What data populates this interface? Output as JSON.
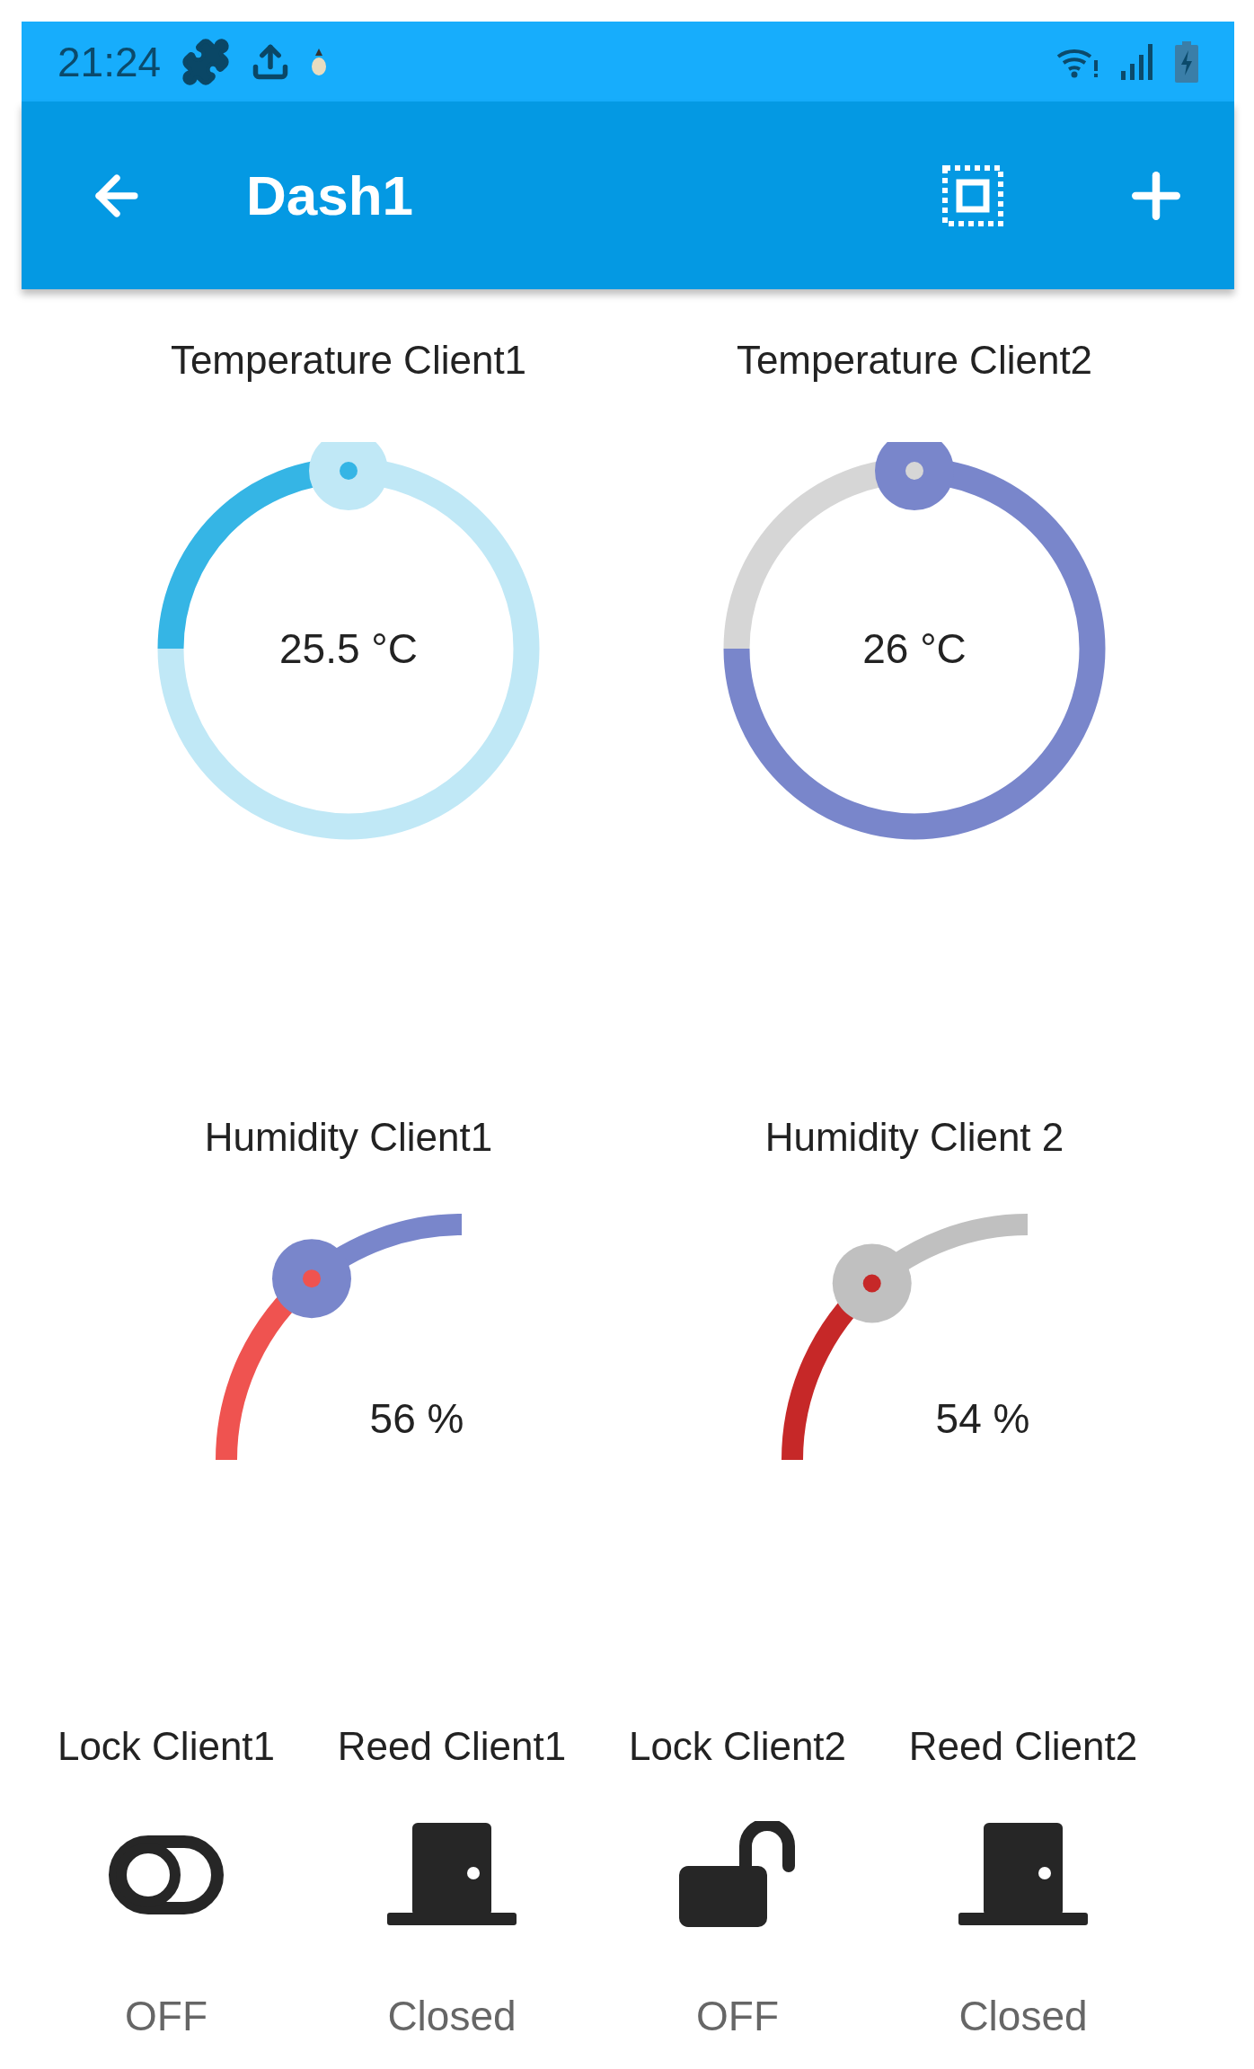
{
  "status_bar": {
    "time": "21:24"
  },
  "app_bar": {
    "title": "Dash1"
  },
  "gauges": [
    {
      "kind": "circle",
      "title": "Temperature Client1",
      "value": "25.5 °C",
      "color": "#35b5e5"
    },
    {
      "kind": "circle",
      "title": "Temperature Client2",
      "value": "26 °C",
      "color": "#d6d6d6"
    },
    {
      "kind": "quarter",
      "title": "Humidity Client1",
      "value": "56 %",
      "color": "#ef5350"
    },
    {
      "kind": "quarter",
      "title": "Humidity Client 2",
      "value": "54 %",
      "color": "#c62828"
    }
  ],
  "tiles": [
    {
      "kind": "toggle",
      "label": "Lock Client1",
      "state": "OFF"
    },
    {
      "kind": "door",
      "label": "Reed Client1",
      "state": "Closed"
    },
    {
      "kind": "lock",
      "label": "Lock Client2",
      "state": "OFF"
    },
    {
      "kind": "door",
      "label": "Reed Client2",
      "state": "Closed"
    }
  ]
}
